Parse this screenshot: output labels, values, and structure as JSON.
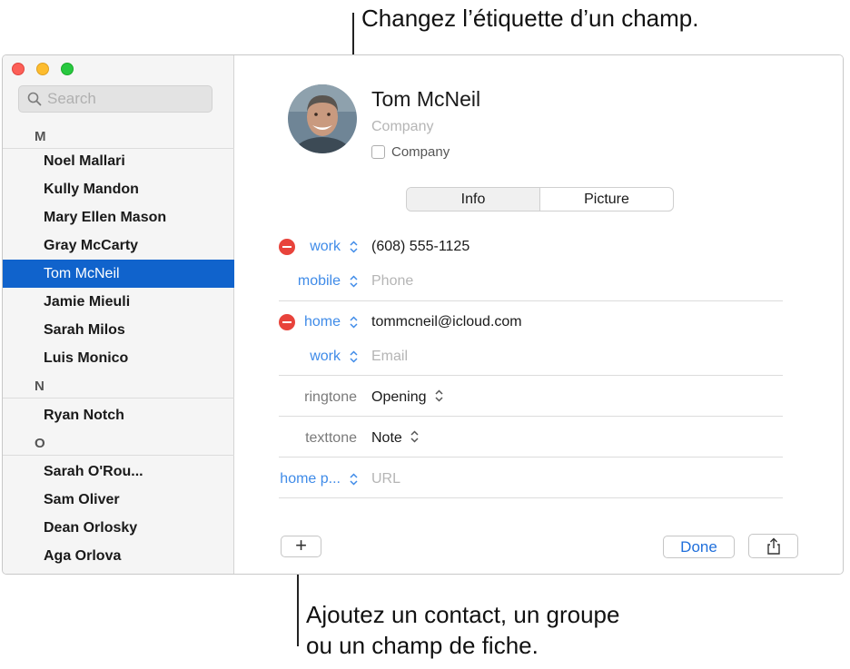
{
  "annotations": {
    "top": "Changez l’étiquette d’un champ.",
    "bottom_line1": "Ajoutez un contact, un groupe",
    "bottom_line2": "ou un champ de fiche."
  },
  "sidebar": {
    "search_placeholder": "Search",
    "sections": [
      {
        "letter": "M",
        "contacts": [
          "Noel Mallari",
          "Kully Mandon",
          "Mary Ellen Mason",
          "Gray McCarty",
          "Tom McNeil",
          "Jamie Mieuli",
          "Sarah Milos",
          "Luis Monico"
        ]
      },
      {
        "letter": "N",
        "contacts": [
          "Ryan Notch"
        ]
      },
      {
        "letter": "O",
        "contacts": [
          "Sarah O'Rou...",
          "Sam Oliver",
          "Dean Orlosky",
          "Aga Orlova"
        ]
      }
    ],
    "selected_contact": "Tom McNeil"
  },
  "card": {
    "name": "Tom  McNeil",
    "company_placeholder": "Company",
    "company_checkbox_label": "Company",
    "tabs": [
      "Info",
      "Picture"
    ],
    "active_tab": "Info",
    "fields": {
      "phone1": {
        "label": "work",
        "value": "(608) 555-1125"
      },
      "phone2": {
        "label": "mobile",
        "placeholder": "Phone"
      },
      "email1": {
        "label": "home",
        "value": "tommcneil@icloud.com"
      },
      "email2": {
        "label": "work",
        "placeholder": "Email"
      },
      "ringtone": {
        "label": "ringtone",
        "value": "Opening"
      },
      "texttone": {
        "label": "texttone",
        "value": "Note"
      },
      "url": {
        "label": "home p...",
        "placeholder": "URL"
      }
    }
  },
  "toolbar": {
    "add_label": "+",
    "done_label": "Done"
  },
  "colors": {
    "selection": "#1063cc",
    "accent": "#3f8be8",
    "delete": "#e8433b"
  },
  "icons": [
    "search-icon",
    "minus-circle-icon",
    "updown-chevron-icon",
    "share-icon",
    "avatar-photo"
  ]
}
